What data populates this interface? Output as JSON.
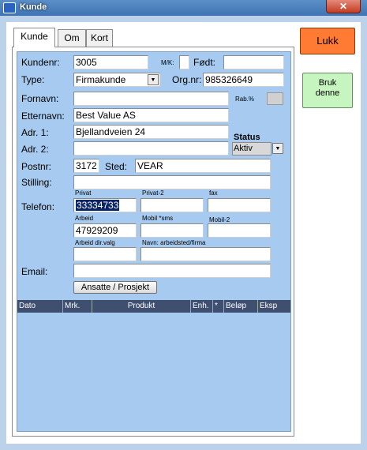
{
  "window": {
    "title": "Kunde",
    "close_label": "✕"
  },
  "tabs": [
    {
      "label": "Kunde"
    },
    {
      "label": "Om"
    },
    {
      "label": "Kort"
    }
  ],
  "side_buttons": {
    "lukk": "Lukk",
    "bruk_line1": "Bruk",
    "bruk_line2": "denne"
  },
  "form": {
    "kundenr_label": "Kundenr:",
    "kundenr_value": "3005",
    "mk_label": "M/K:",
    "mk_value": "",
    "fodt_label": "Født:",
    "fodt_value": "",
    "type_label": "Type:",
    "type_value": "Firmakunde",
    "orgnr_label": "Org.nr:",
    "orgnr_value": "985326649",
    "fornavn_label": "Fornavn:",
    "fornavn_value": "",
    "rab_label": "Rab.%",
    "etternavn_label": "Etternavn:",
    "etternavn_value": "Best Value AS",
    "adr1_label": "Adr. 1:",
    "adr1_value": "Bjellandveien 24",
    "status_label": "Status",
    "status_value": "Aktiv",
    "adr2_label": "Adr. 2:",
    "adr2_value": "",
    "postnr_label": "Postnr:",
    "postnr_value": "3172",
    "sted_label": "Sted:",
    "sted_value": "VEAR",
    "stilling_label": "Stilling:",
    "stilling_value": "",
    "telefon_label": "Telefon:",
    "privat_label": "Privat",
    "privat_value": "33334733",
    "privat2_label": "Privat-2",
    "privat2_value": "",
    "fax_label": "fax",
    "fax_value": "",
    "arbeid_label": "Arbeid",
    "arbeid_value": "47929209",
    "mobil_label": "Mobil *sms",
    "mobil_value": "",
    "mobil2_label": "Mobil-2",
    "mobil2_value": "",
    "arbeid_dir_label": "Arbeid dir.valg",
    "arbeid_dir_value": "",
    "navn_arbeid_label": "Navn: arbeidsted/firma",
    "navn_arbeid_value": "",
    "email_label": "Email:",
    "email_value": "",
    "ansatte_button": "Ansatte / Prosjekt"
  },
  "grid": {
    "columns": [
      "Dato",
      "Mrk.",
      "Produkt",
      "Enh.",
      "*",
      "Beløp",
      "Eksp"
    ]
  },
  "colors": {
    "lukk": "#ff7a33",
    "bruk": "#c7f5c0",
    "form_bg": "#a6caf0",
    "grid_header": "#3f4f6f"
  }
}
